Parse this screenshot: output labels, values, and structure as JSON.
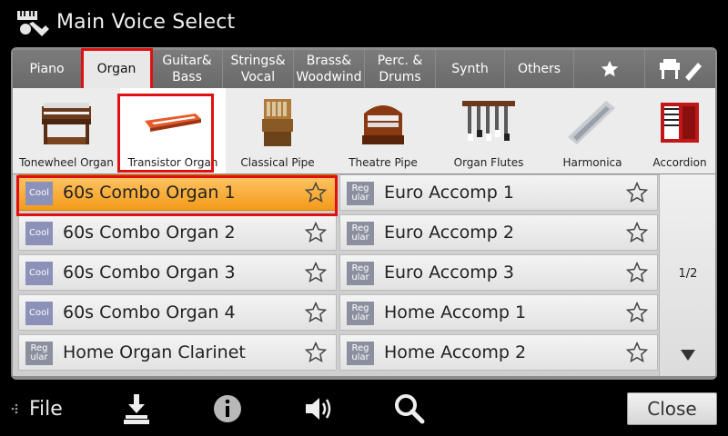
{
  "header": {
    "title": "Main Voice Select"
  },
  "tabs": [
    {
      "label": "Piano"
    },
    {
      "label": "Organ",
      "active": true
    },
    {
      "label": "Guitar&\nBass"
    },
    {
      "label": "Strings&\nVocal"
    },
    {
      "label": "Brass&\nWoodwind"
    },
    {
      "label": "Perc. &\nDrums"
    },
    {
      "label": "Synth"
    },
    {
      "label": "Others"
    },
    {
      "icon": "star-icon"
    },
    {
      "icon": "expansion-keyboard-icon"
    }
  ],
  "categories": [
    {
      "label": "Tonewheel Organ"
    },
    {
      "label": "Transistor Organ",
      "active": true
    },
    {
      "label": "Classical Pipe"
    },
    {
      "label": "Theatre Pipe"
    },
    {
      "label": "Organ Flutes"
    },
    {
      "label": "Harmonica"
    },
    {
      "label": "Accordion"
    }
  ],
  "voices": {
    "left": [
      {
        "badge": "Cool",
        "name": "60s Combo Organ 1",
        "selected": true
      },
      {
        "badge": "Cool",
        "name": "60s Combo Organ 2"
      },
      {
        "badge": "Cool",
        "name": "60s Combo Organ 3"
      },
      {
        "badge": "Cool",
        "name": "60s Combo Organ 4"
      },
      {
        "badge": "Reg\nular",
        "name": "Home Organ Clarinet"
      }
    ],
    "right": [
      {
        "badge": "Reg\nular",
        "name": "Euro Accomp 1"
      },
      {
        "badge": "Reg\nular",
        "name": "Euro Accomp 2"
      },
      {
        "badge": "Reg\nular",
        "name": "Euro Accomp 3"
      },
      {
        "badge": "Reg\nular",
        "name": "Home Accomp 1"
      },
      {
        "badge": "Reg\nular",
        "name": "Home Accomp 2"
      }
    ]
  },
  "pager": {
    "page": "1/2"
  },
  "bottom": {
    "file_label": "File",
    "close_label": "Close"
  },
  "colors": {
    "selection": "#f5a623",
    "highlight_box": "#e01010",
    "cool_badge": "#8b91b8",
    "regular_badge": "#8c8f9e"
  }
}
